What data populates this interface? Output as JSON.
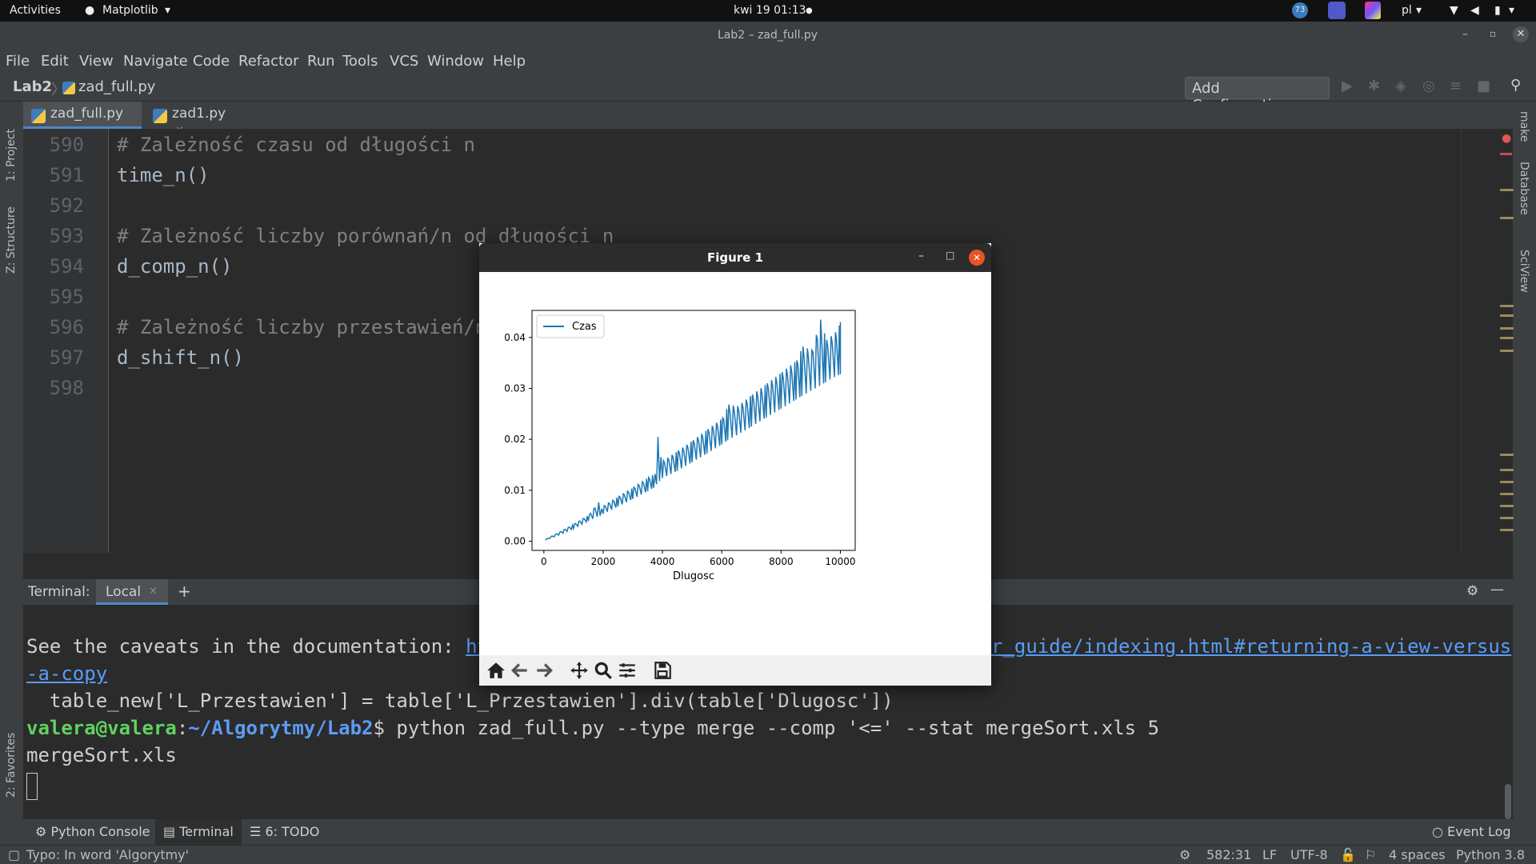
{
  "topbar": {
    "activities": "Activities",
    "app_name": "Matplotlib",
    "clock": "kwi 19  01:13",
    "badge_count": "73",
    "language": "pl"
  },
  "window_title": "Lab2 – zad_full.py",
  "menu": [
    "File",
    "Edit",
    "View",
    "Navigate",
    "Code",
    "Refactor",
    "Run",
    "Tools",
    "VCS",
    "Window",
    "Help"
  ],
  "breadcrumb": {
    "project": "Lab2",
    "file": "zad_full.py"
  },
  "run_config": "Add Configuration...",
  "tabs": [
    {
      "label": "zad_full.py",
      "active": true
    },
    {
      "label": "zad1.py",
      "active": false
    }
  ],
  "side_panels": {
    "left": [
      "1: Project",
      "Z: Structure",
      "2: Favorites"
    ],
    "right": [
      "make",
      "Database",
      "SciView"
    ]
  },
  "editor": {
    "lines": [
      {
        "num": "590",
        "text": "# Zależność czasu od długości n",
        "comment": true
      },
      {
        "num": "591",
        "text": "time_n()",
        "comment": false
      },
      {
        "num": "592",
        "text": "",
        "comment": false
      },
      {
        "num": "593",
        "text": "# Zależność liczby porównań/n od długości n",
        "comment": true
      },
      {
        "num": "594",
        "text": "d_comp_n()",
        "comment": false
      },
      {
        "num": "595",
        "text": "",
        "comment": false
      },
      {
        "num": "596",
        "text": "# Zależność liczby przestawień/n",
        "comment": true
      },
      {
        "num": "597",
        "text": "d_shift_n()",
        "comment": false
      },
      {
        "num": "598",
        "text": "",
        "comment": false
      }
    ]
  },
  "terminal": {
    "label": "Terminal:",
    "tab": "Local",
    "lines": {
      "caveat_prefix": "See the caveats in the documentation: ",
      "caveat_link_start": "htt",
      "caveat_link_end": "r_guide/indexing.html#returning-a-view-versus",
      "caveat_link_wrap": "-a-copy",
      "code_line": "  table_new['L_Przestawien'] = table['L_Przestawien'].div(table['Dlugosc'])",
      "prompt_user": "valera@valera",
      "prompt_path": "~/Algorytmy/Lab2",
      "prompt_cmd": "$ python zad_full.py --type merge --comp '<=' --stat mergeSort.xls 5",
      "output": "mergeSort.xls"
    }
  },
  "toolwindows": [
    "Python Console",
    "Terminal",
    "6: TODO"
  ],
  "event_log": "Event Log",
  "status": {
    "message": "Typo: In word 'Algorytmy'",
    "position": "582:31",
    "line_sep": "LF",
    "encoding": "UTF-8",
    "indent": "4 spaces",
    "interpreter": "Python 3.8"
  },
  "figure": {
    "title": "Figure 1"
  },
  "chart_data": {
    "type": "line",
    "title": "",
    "xlabel": "Dlugosc",
    "ylabel": "",
    "xlim": [
      -400,
      10500
    ],
    "ylim": [
      -0.0018,
      0.0453
    ],
    "xticks": [
      0,
      2000,
      4000,
      6000,
      8000,
      10000
    ],
    "yticks": [
      0.0,
      0.01,
      0.02,
      0.03,
      0.04
    ],
    "ytick_labels": [
      "0.00",
      "0.01",
      "0.02",
      "0.03",
      "0.04"
    ],
    "legend_position": "top-left",
    "series": [
      {
        "name": "Czas",
        "color": "#1f77b4",
        "x": [
          50,
          500,
          1000,
          1500,
          1800,
          1900,
          2000,
          2500,
          3000,
          3500,
          3700,
          3800,
          3900,
          4000,
          4500,
          5000,
          5500,
          6000,
          6200,
          6500,
          7000,
          7500,
          8000,
          8500,
          8700,
          9000,
          9300,
          9500,
          9800,
          10000
        ],
        "y_low": [
          0.0002,
          0.0012,
          0.0025,
          0.004,
          0.0048,
          0.005,
          0.0054,
          0.0068,
          0.0083,
          0.0098,
          0.0105,
          0.0112,
          0.0118,
          0.0124,
          0.0138,
          0.0155,
          0.0172,
          0.019,
          0.0198,
          0.0208,
          0.0225,
          0.0243,
          0.026,
          0.0278,
          0.0285,
          0.0295,
          0.0305,
          0.0312,
          0.0322,
          0.0328
        ],
        "y_high": [
          0.0004,
          0.0018,
          0.0034,
          0.0052,
          0.0076,
          0.0064,
          0.007,
          0.0088,
          0.0106,
          0.0125,
          0.0132,
          0.0205,
          0.0165,
          0.0158,
          0.0178,
          0.0198,
          0.022,
          0.0242,
          0.0268,
          0.0265,
          0.0288,
          0.031,
          0.0332,
          0.0355,
          0.0382,
          0.0375,
          0.0435,
          0.0395,
          0.041,
          0.043
        ]
      }
    ]
  },
  "colors": {
    "accent": "#4a88c7",
    "series": "#1f77b4",
    "close_button": "#e95420"
  }
}
